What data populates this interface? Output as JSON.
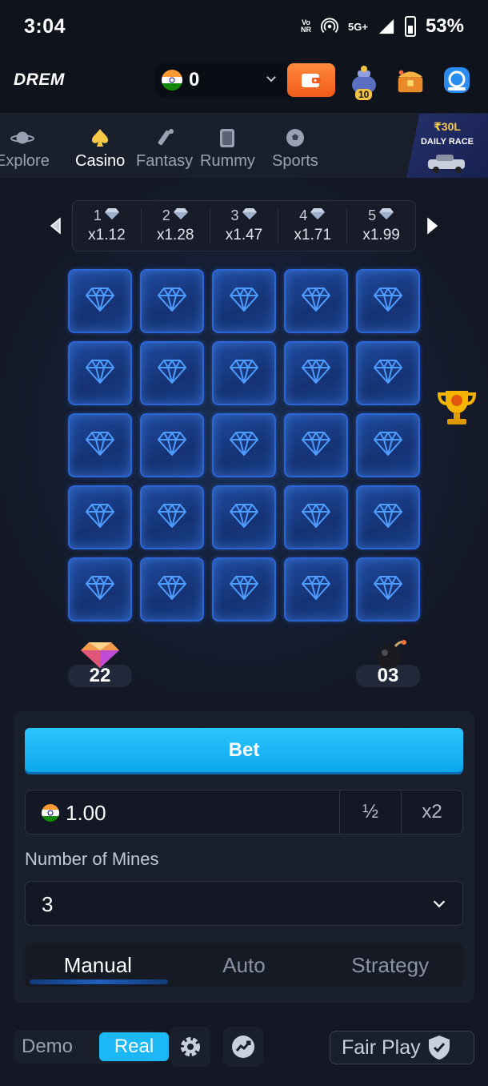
{
  "status_bar": {
    "time": "3:04",
    "network_top": "Vo",
    "network_bottom": "NR",
    "network_type": "5G+",
    "battery": "53%"
  },
  "header": {
    "logo": "DREM",
    "balance": "0",
    "currency_flag": "india-flag-icon"
  },
  "nav": {
    "items": [
      {
        "label": "Explore",
        "icon": "planet-icon"
      },
      {
        "label": "Casino",
        "icon": "spade-icon"
      },
      {
        "label": "Fantasy",
        "icon": "cricket-icon"
      },
      {
        "label": "Rummy",
        "icon": "cards-icon"
      },
      {
        "label": "Sports",
        "icon": "football-icon"
      }
    ],
    "active": "Casino",
    "race_banner": {
      "amount": "₹30L",
      "label": "DAILY RACE"
    }
  },
  "multipliers": [
    {
      "gems": "1",
      "value": "x1.12"
    },
    {
      "gems": "2",
      "value": "x1.28"
    },
    {
      "gems": "3",
      "value": "x1.47"
    },
    {
      "gems": "4",
      "value": "x1.71"
    },
    {
      "gems": "5",
      "value": "x1.99"
    }
  ],
  "grid": {
    "rows": 5,
    "cols": 5
  },
  "counts": {
    "gems": "22",
    "mines": "03"
  },
  "panel": {
    "bet_label": "Bet",
    "amount": "1.00",
    "half_label": "½",
    "double_label": "x2",
    "mines_label": "Number of Mines",
    "mines_value": "3",
    "tabs": [
      "Manual",
      "Auto",
      "Strategy"
    ],
    "active_tab": "Manual"
  },
  "footer": {
    "demo_label": "Demo",
    "real_label": "Real",
    "fairplay_label": "Fair Play"
  },
  "colors": {
    "accent": "#1cb8f5",
    "wallet": "#f15a1b",
    "tile": "#1f4a9e",
    "race_gold": "#f7c948"
  }
}
